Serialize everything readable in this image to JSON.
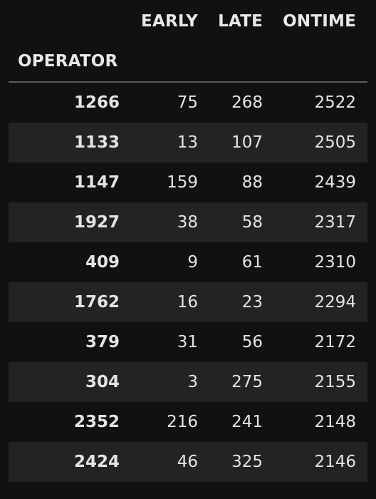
{
  "columns": {
    "early": "EARLY",
    "late": "LATE",
    "ontime": "ONTIME"
  },
  "index_name": "OPERATOR",
  "rows": [
    {
      "operator": "1266",
      "early": "75",
      "late": "268",
      "ontime": "2522"
    },
    {
      "operator": "1133",
      "early": "13",
      "late": "107",
      "ontime": "2505"
    },
    {
      "operator": "1147",
      "early": "159",
      "late": "88",
      "ontime": "2439"
    },
    {
      "operator": "1927",
      "early": "38",
      "late": "58",
      "ontime": "2317"
    },
    {
      "operator": "409",
      "early": "9",
      "late": "61",
      "ontime": "2310"
    },
    {
      "operator": "1762",
      "early": "16",
      "late": "23",
      "ontime": "2294"
    },
    {
      "operator": "379",
      "early": "31",
      "late": "56",
      "ontime": "2172"
    },
    {
      "operator": "304",
      "early": "3",
      "late": "275",
      "ontime": "2155"
    },
    {
      "operator": "2352",
      "early": "216",
      "late": "241",
      "ontime": "2148"
    },
    {
      "operator": "2424",
      "early": "46",
      "late": "325",
      "ontime": "2146"
    }
  ],
  "colors": {
    "background": "#111111",
    "stripe": "#232323",
    "text": "#e4e4e4",
    "rule": "#5a5a5a"
  }
}
